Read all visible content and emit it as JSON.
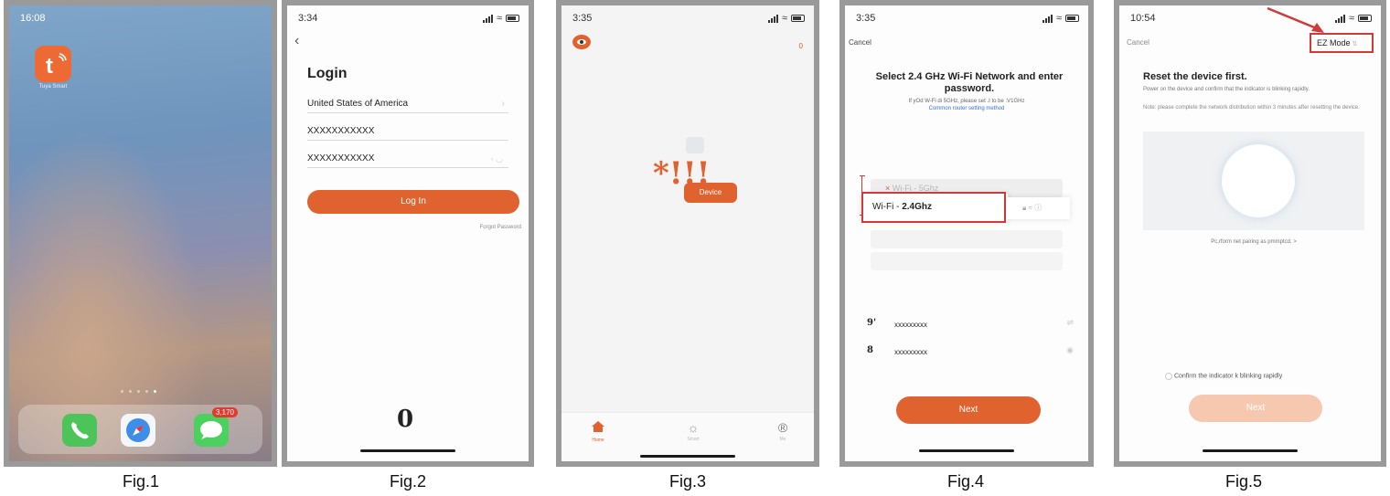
{
  "figures": [
    {
      "caption": "Fig.1",
      "status_time": "16:08",
      "app_label": "Tuya Smart",
      "dock_badge": "3,170"
    },
    {
      "caption": "Fig.2",
      "status_time": "3:34",
      "title": "Login",
      "country": "United States of America",
      "account": "XXXXXXXXXXX",
      "password": "XXXXXXXXXXX",
      "login_button": "Log In",
      "forgot_password": "Forgot Password",
      "bottom_glyph": "0"
    },
    {
      "caption": "Fig.3",
      "status_time": "3:35",
      "top_right": "0",
      "artifact": "*!!!",
      "add_device_button": "Device",
      "tabs": [
        {
          "label": "Home",
          "icon": "home-icon"
        },
        {
          "label": "Smart",
          "icon": "sun-icon"
        },
        {
          "label": "Me",
          "icon": "registered-icon",
          "glyph": "®"
        }
      ]
    },
    {
      "caption": "Fig.4",
      "status_time": "3:35",
      "cancel": "Cancel",
      "heading": "Select 2.4 GHz Wi-Fi Network and enter password.",
      "subtext": "If yOd W-Fi di 5GHz, please set .I to be :V1GHz",
      "link": "Common router setting method",
      "network_5g": "Wi-Fi - 5Ghz",
      "network_24_prefix": "Wi-Fi - ",
      "network_24_band": "2.4Ghz",
      "wifi_name_icon": "9'",
      "wifi_name": "xxxxxxxxx",
      "wifi_pwd_icon": "8",
      "wifi_pwd": "xxxxxxxxx",
      "next_button": "Next"
    },
    {
      "caption": "Fig.5",
      "status_time": "10:54",
      "cancel": "Cancel",
      "mode": "EZ Mode",
      "heading": "Reset the device first.",
      "desc1": "Power on the device and confirm that the indicator is blinking rapidly.",
      "desc2": "Note: please complete the network distribution within 3 minutes after resetting the device.",
      "perform": "Pc,rform net pairing as pmmptcd. >",
      "confirm": "Confirm the indicator k blinking rapidly",
      "next_button": "Next"
    }
  ],
  "colors": {
    "accent": "#e0622e",
    "highlight": "#d23a3a",
    "frame": "#9a9a9a",
    "link": "#3a6fd8"
  }
}
